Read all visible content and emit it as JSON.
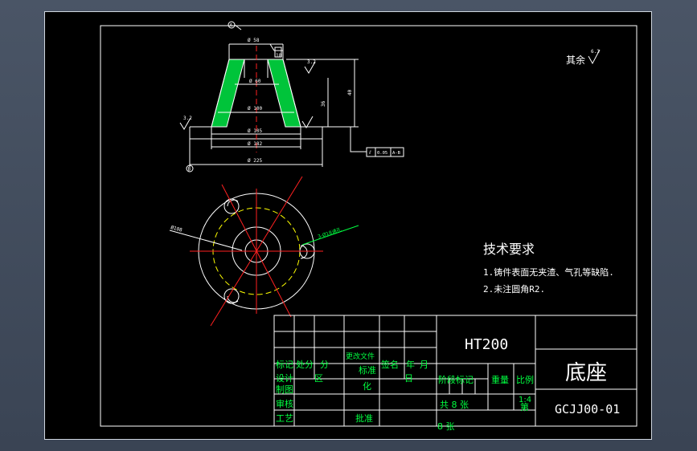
{
  "drawing": {
    "dimensions": {
      "top_diameter": "Ø 58",
      "hole_upper": "Ø 60",
      "hole_middle": "Ø 100",
      "base_inner": "Ø 105",
      "base_mid": "Ø 182",
      "base_outer": "Ø 225",
      "total_height": "40",
      "inner_height": "36",
      "slot_width": "18",
      "circle_label": "Ø108",
      "hole_callout": "3-Ø18通孔"
    },
    "surface_marks": {
      "top": "3.2",
      "left": "3.2",
      "right": "3.2",
      "other": "6.3",
      "other_label": "其余"
    },
    "datum": {
      "a": "A",
      "b": "B"
    },
    "tolerance": {
      "symbol": "⫽",
      "value": "0.05",
      "datum": "A-B"
    }
  },
  "notes": {
    "title": "技术要求",
    "line1": "1.铸件表面无夹渣、气孔等缺陷.",
    "line2": "2.未注圆角R2."
  },
  "title_block": {
    "material": "HT200",
    "part_name": "底座",
    "drawing_no": "GCJJ00-01",
    "row1": [
      "标记",
      "处分",
      "分",
      "更改文件",
      "签名",
      "年",
      "月"
    ],
    "row1b": [
      "设计",
      "区",
      "标准",
      "日"
    ],
    "row2": [
      "制图",
      "化"
    ],
    "row3": [
      "审核"
    ],
    "row4": [
      "工艺",
      "批准"
    ],
    "stage_label": "阶段标记",
    "weight_label": "重量",
    "scale_label": "比例",
    "scale_value": "1:4",
    "sheet_total": "共  8  张",
    "sheet_no": "第",
    "sheet_of": "8  张"
  }
}
